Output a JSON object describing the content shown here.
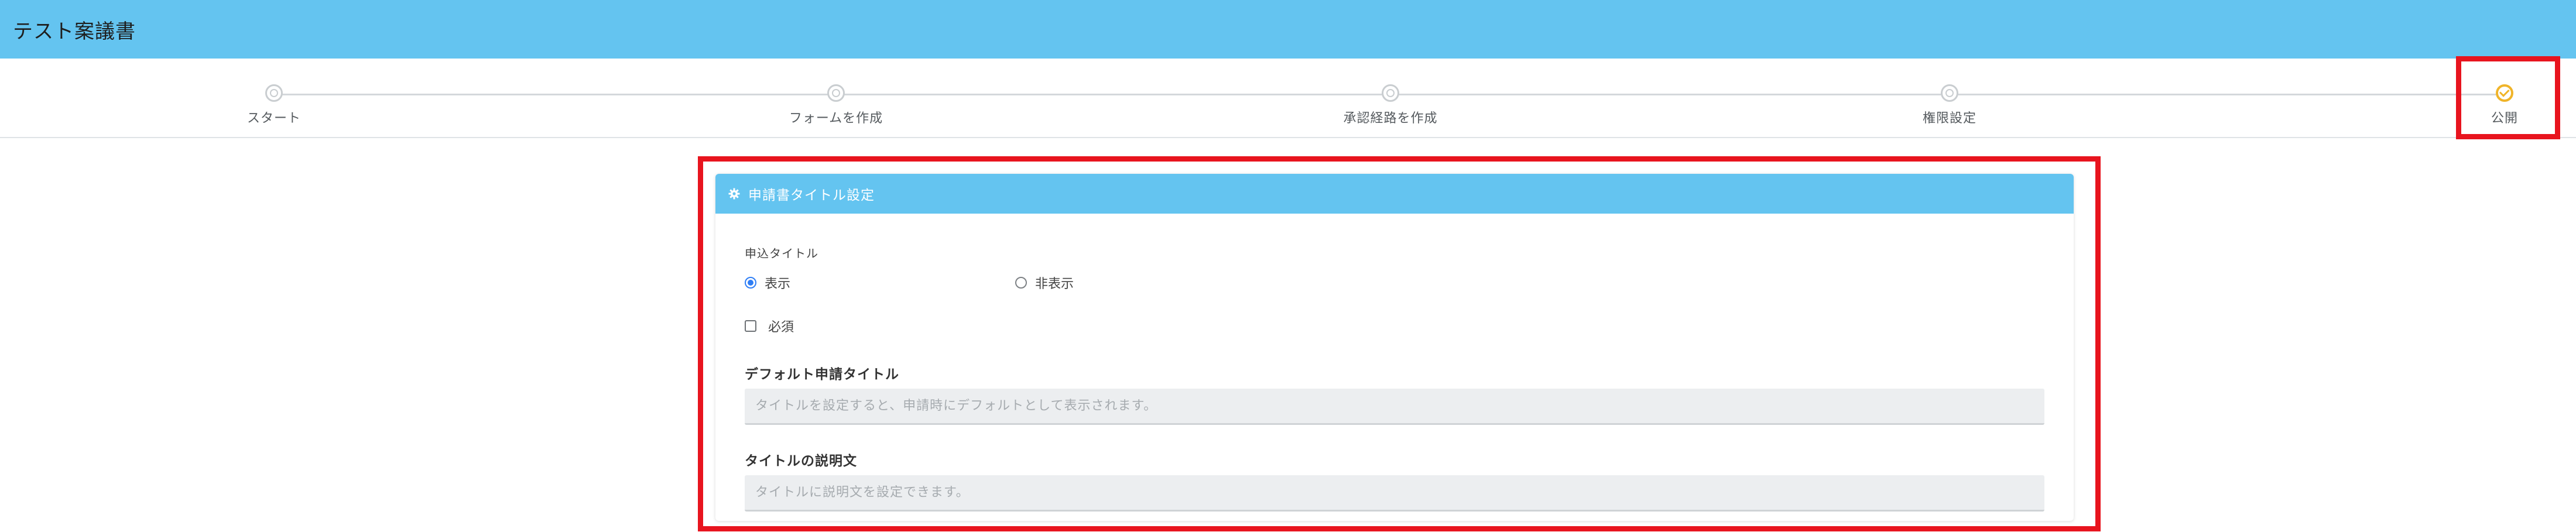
{
  "app": {
    "title": "テスト案議書"
  },
  "stepper": {
    "steps": [
      {
        "label": "スタート",
        "state": "done"
      },
      {
        "label": "フォームを作成",
        "state": "done"
      },
      {
        "label": "承認経路を作成",
        "state": "done"
      },
      {
        "label": "権限設定",
        "state": "done"
      },
      {
        "label": "公開",
        "state": "active"
      }
    ]
  },
  "card": {
    "header_icon": "gear-icon",
    "header_title": "申請書タイトル設定",
    "title_section_label": "申込タイトル",
    "radio_show_label": "表示",
    "radio_hide_label": "非表示",
    "radio_selected": "表示",
    "required_label": "必須",
    "required_checked": false,
    "default_title_label": "デフォルト申請タイトル",
    "default_title_value": "",
    "default_title_placeholder": "タイトルを設定すると、申請時にデフォルトとして表示されます。",
    "description_label": "タイトルの説明文",
    "description_value": "",
    "description_placeholder": "タイトルに説明文を設定できます。"
  },
  "colors": {
    "header_blue": "#64c4f0",
    "highlight_red": "#e8141e",
    "active_step": "#f0b429",
    "radio_selected": "#2f7ef5"
  }
}
